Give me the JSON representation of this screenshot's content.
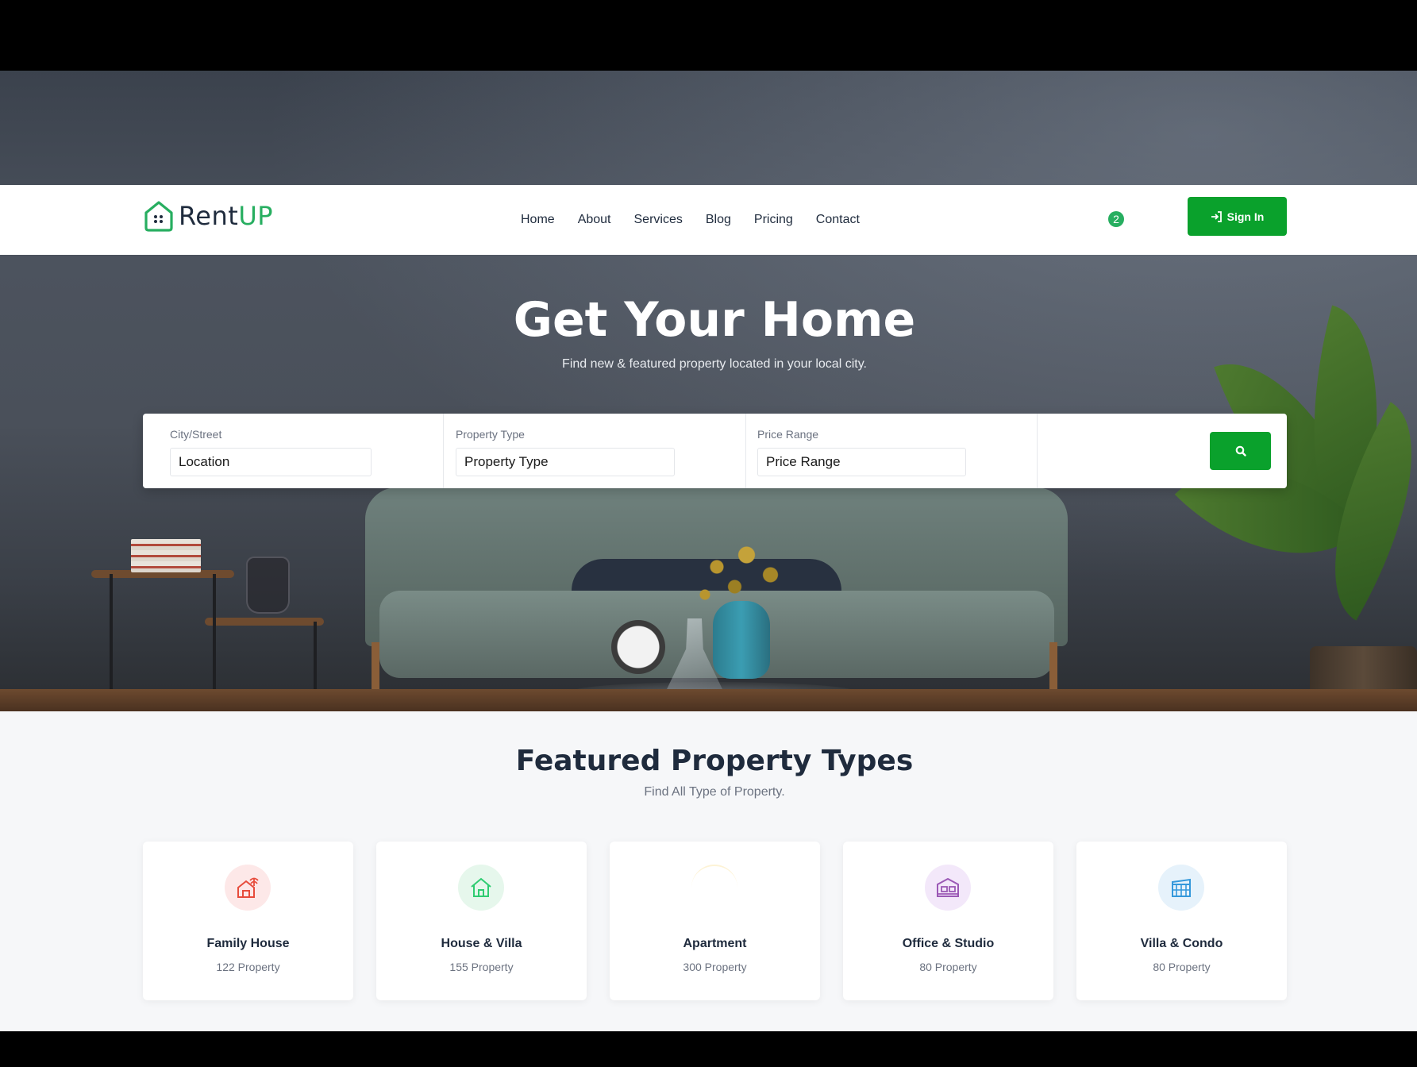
{
  "brand": {
    "name_main": "Rent",
    "name_accent": "UP"
  },
  "nav": {
    "items": [
      "Home",
      "About",
      "Services",
      "Blog",
      "Pricing",
      "Contact"
    ]
  },
  "header": {
    "badge_count": "2",
    "signin_label": "Sign In"
  },
  "hero": {
    "title": "Get Your Home",
    "subtitle": "Find new & featured property located in your local city."
  },
  "search": {
    "fields": [
      {
        "label": "City/Street",
        "value": "Location"
      },
      {
        "label": "Property Type",
        "value": "Property Type"
      },
      {
        "label": "Price Range",
        "value": "Price Range"
      }
    ]
  },
  "featured": {
    "title": "Featured Property Types",
    "subtitle": "Find All Type of Property.",
    "cards": [
      {
        "title": "Family House",
        "count": "122 Property",
        "icon": "family-house-icon",
        "color": "#e74c3c",
        "bg": "#fde8e8"
      },
      {
        "title": "House & Villa",
        "count": "155 Property",
        "icon": "house-villa-icon",
        "color": "#2ecc71",
        "bg": "#e6f7ec"
      },
      {
        "title": "Apartment",
        "count": "300 Property",
        "icon": "apartment-icon",
        "color": "#f1c40f",
        "bg": "#fff8e1"
      },
      {
        "title": "Office & Studio",
        "count": "80 Property",
        "icon": "office-studio-icon",
        "color": "#9b59b6",
        "bg": "#f3e8fa"
      },
      {
        "title": "Villa & Condo",
        "count": "80 Property",
        "icon": "villa-condo-icon",
        "color": "#3498db",
        "bg": "#e6f2fb"
      }
    ]
  },
  "colors": {
    "accent": "#0aa12c",
    "brand_green": "#27ae60",
    "text_dark": "#1f2b3d"
  }
}
